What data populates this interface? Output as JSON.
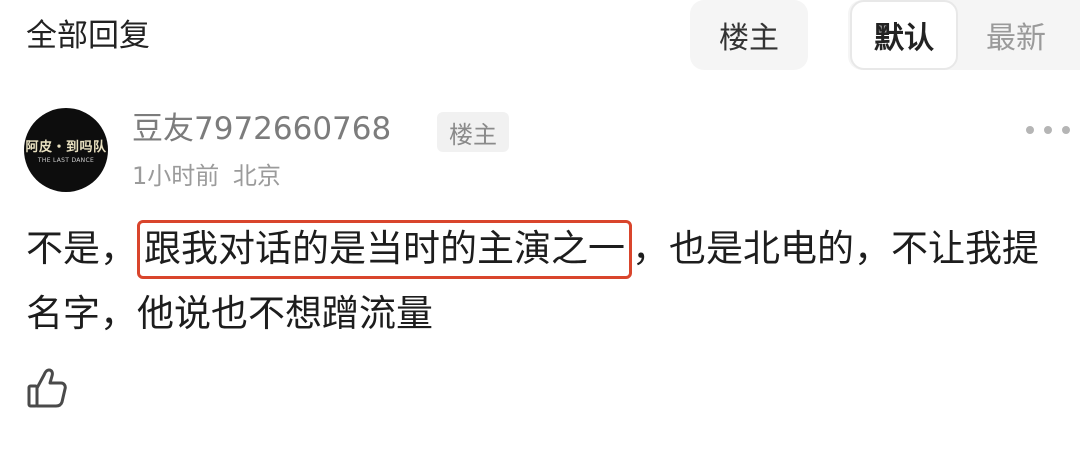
{
  "header": {
    "title": "全部回复",
    "filter_poster_label": "楼主",
    "sort_default_label": "默认",
    "sort_latest_label": "最新"
  },
  "comment": {
    "avatar_text_main": "阿皮・到吗队",
    "avatar_text_sub": "THE LAST DANCE",
    "username": "豆友7972660768",
    "badge": "楼主",
    "time": "1小时前",
    "location": "北京",
    "body_before": "不是，",
    "body_highlight": "跟我对话的是当时的主演之一",
    "body_after": "，也是北电的，不让我提名字，他说也不想蹭流量"
  },
  "icons": {
    "more": "more-icon",
    "like": "thumbs-up-icon"
  },
  "colors": {
    "highlight_border": "#d9452c",
    "muted_text": "#7c7c7c",
    "chip_bg": "#f5f5f5"
  }
}
